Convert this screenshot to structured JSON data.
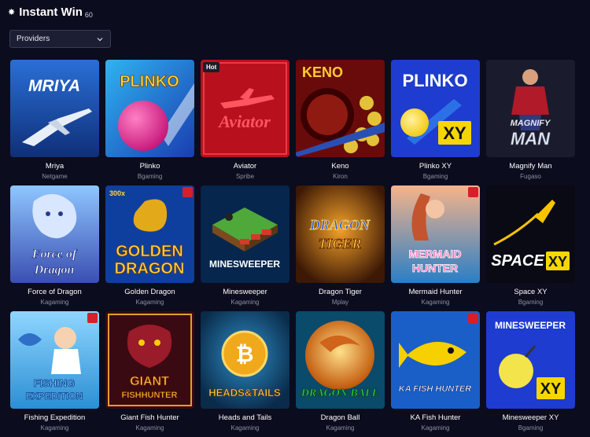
{
  "header": {
    "title": "Instant Win",
    "count": "60"
  },
  "filter": {
    "label": "Providers"
  },
  "games": [
    {
      "id": "mriya",
      "name": "Mriya",
      "provider": "Netgame",
      "art": "MRIYA"
    },
    {
      "id": "plinko",
      "name": "Plinko",
      "provider": "Bgaming",
      "art": "PLINKO"
    },
    {
      "id": "aviator",
      "name": "Aviator",
      "provider": "Spribe",
      "art": "Aviator",
      "badge": "Hot"
    },
    {
      "id": "keno",
      "name": "Keno",
      "provider": "Kiron",
      "art": "KENO"
    },
    {
      "id": "plinko-xy",
      "name": "Plinko XY",
      "provider": "Bgaming",
      "art": "PLINKO",
      "art2": "XY"
    },
    {
      "id": "magnify-man",
      "name": "Magnify Man",
      "provider": "Fugaso",
      "art": "MAGNIFY",
      "art2": "MAN"
    },
    {
      "id": "force-of-dragon",
      "name": "Force of Dragon",
      "provider": "Kagaming",
      "art": "Force of",
      "art2": "Dragon"
    },
    {
      "id": "golden-dragon",
      "name": "Golden Dragon",
      "provider": "Kagaming",
      "art": "GOLDEN",
      "art2": "DRAGON",
      "art3": "300x"
    },
    {
      "id": "minesweeper",
      "name": "Minesweeper",
      "provider": "Kagaming",
      "art": "MINESWEEPER"
    },
    {
      "id": "dragon-tiger",
      "name": "Dragon Tiger",
      "provider": "Mplay",
      "art": "DRAGON",
      "art2": "TIGER"
    },
    {
      "id": "mermaid-hunter",
      "name": "Mermaid Hunter",
      "provider": "Kagaming",
      "art": "MERMAID",
      "art2": "HUNTER"
    },
    {
      "id": "space-xy",
      "name": "Space XY",
      "provider": "Bgaming",
      "art": "SPACE",
      "art2": "XY"
    },
    {
      "id": "fishing-expedition",
      "name": "Fishing Expedition",
      "provider": "Kagaming",
      "art": "FISHING",
      "art2": "EXPEDITION"
    },
    {
      "id": "giant-fish-hunter",
      "name": "Giant Fish Hunter",
      "provider": "Kagaming",
      "art": "GIANT",
      "art2": "FISHHUNTER"
    },
    {
      "id": "heads-and-tails",
      "name": "Heads and Tails",
      "provider": "Kagaming",
      "art": "HEADS&TAILS"
    },
    {
      "id": "dragon-ball",
      "name": "Dragon Ball",
      "provider": "Kagaming",
      "art": "DRAGON BALL"
    },
    {
      "id": "ka-fish-hunter",
      "name": "KA Fish Hunter",
      "provider": "Kagaming",
      "art": "KA FISH HUNTER"
    },
    {
      "id": "minesweeper-xy",
      "name": "Minesweeper XY",
      "provider": "Bgaming",
      "art": "MINESWEEPER",
      "art2": "XY"
    }
  ]
}
